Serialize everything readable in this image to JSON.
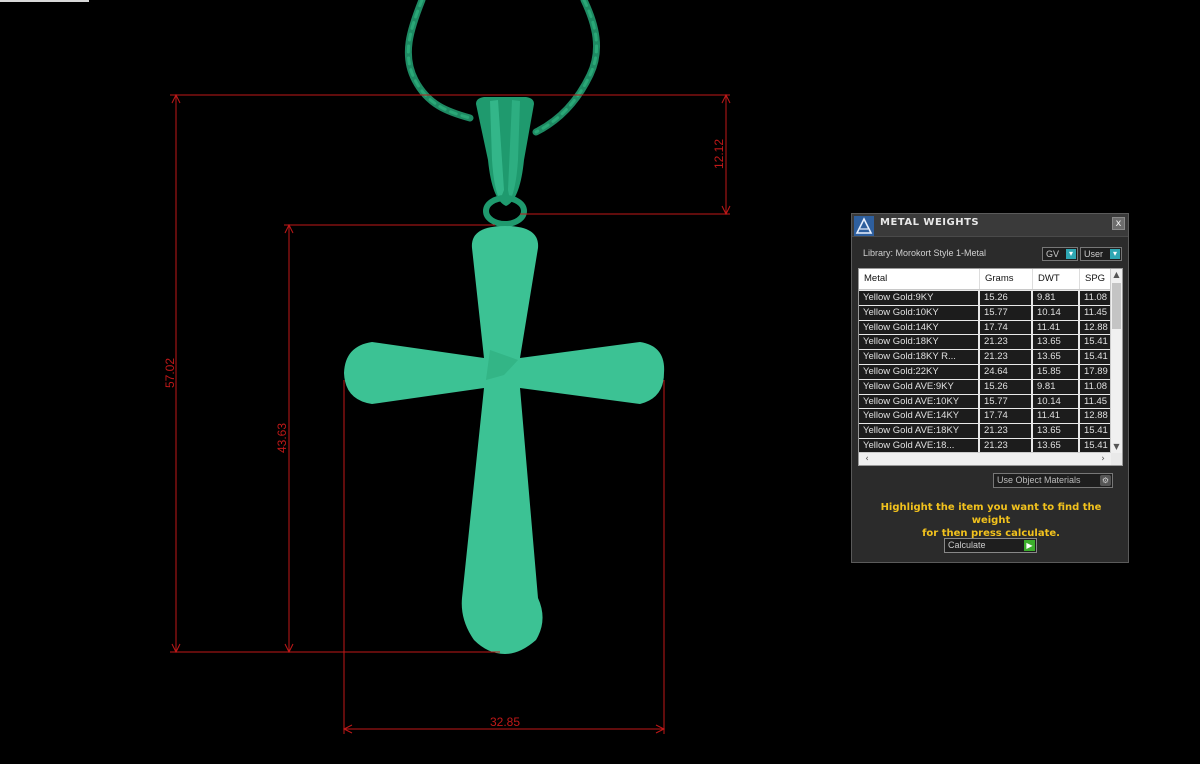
{
  "viewport": {
    "dimensions": {
      "height": "57.02",
      "bail": "12.12",
      "cross_height": "43.63",
      "width": "32.85"
    },
    "colors": {
      "model": "#3cc294",
      "chain": "#1e8a63",
      "dimension_lines": "#c01818",
      "background": "#000000"
    }
  },
  "panel": {
    "title": "METAL WEIGHTS",
    "close_label": "x",
    "library_label": "Library: Morokort Style 1-Metal",
    "unit_dropdown": "GV",
    "user_dropdown": "User",
    "columns": [
      "Metal",
      "Grams",
      "DWT",
      "SPG"
    ],
    "rows": [
      [
        "Yellow Gold:9KY",
        "15.26",
        "9.81",
        "11.08"
      ],
      [
        "Yellow Gold:10KY",
        "15.77",
        "10.14",
        "11.45"
      ],
      [
        "Yellow Gold:14KY",
        "17.74",
        "11.41",
        "12.88"
      ],
      [
        "Yellow Gold:18KY",
        "21.23",
        "13.65",
        "15.41"
      ],
      [
        "Yellow Gold:18KY R...",
        "21.23",
        "13.65",
        "15.41"
      ],
      [
        "Yellow Gold:22KY",
        "24.64",
        "15.85",
        "17.89"
      ],
      [
        "Yellow Gold AVE:9KY",
        "15.26",
        "9.81",
        "11.08"
      ],
      [
        "Yellow Gold AVE:10KY",
        "15.77",
        "10.14",
        "11.45"
      ],
      [
        "Yellow Gold AVE:14KY",
        "17.74",
        "11.41",
        "12.88"
      ],
      [
        "Yellow Gold AVE:18KY",
        "21.23",
        "13.65",
        "15.41"
      ],
      [
        "Yellow Gold AVE:18...",
        "21.23",
        "13.65",
        "15.41"
      ]
    ],
    "use_object_materials": "Use Object Materials",
    "hint_line1": "Highlight the item you want to find the weight",
    "hint_line2": "for then press calculate.",
    "calculate_label": "Calculate",
    "colors": {
      "accent": "#2fa7b3",
      "hint": "#f2c21d",
      "go": "#3cae2c"
    }
  }
}
